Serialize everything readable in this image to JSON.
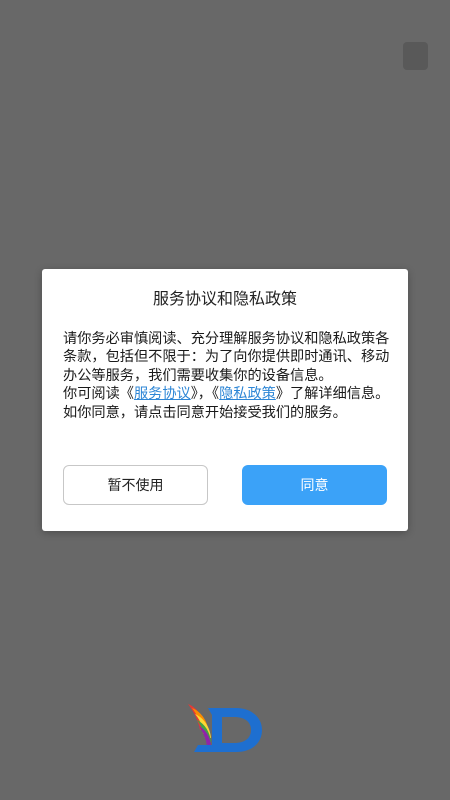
{
  "dialog": {
    "title": "服务协议和隐私政策",
    "paragraph1": "请你务必审慎阅读、充分理解服务协议和隐私政策各条款，包括但不限于：为了向你提供即时通讯、移动办公等服务，我们需要收集你的设备信息。",
    "paragraph2_prefix": "你可阅读《",
    "service_link": "服务协议",
    "paragraph2_middle": "》，《",
    "privacy_link": "隐私政策",
    "paragraph2_suffix": "》了解详细信息。如你同意，请点击同意开始接受我们的服务。",
    "cancel_label": "暂不使用",
    "agree_label": "同意"
  },
  "colors": {
    "overlay": "#686868",
    "accent": "#3ba2f8",
    "link": "#2d86d6"
  },
  "icons": {
    "top_right": "skip-square-icon",
    "bottom_logo": "app-logo-icon"
  }
}
